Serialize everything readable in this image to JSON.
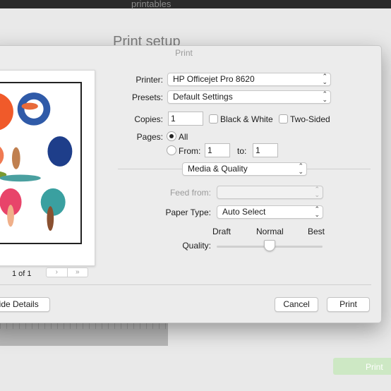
{
  "background": {
    "app_title": "printables",
    "page_title": "Print setup",
    "print_button": "Print"
  },
  "dialog": {
    "title": "Print",
    "printer_label": "Printer:",
    "printer_value": "HP Officejet Pro 8620",
    "presets_label": "Presets:",
    "presets_value": "Default Settings",
    "copies_label": "Copies:",
    "copies_value": "1",
    "bw_label": "Black & White",
    "two_sided_label": "Two-Sided",
    "pages_label": "Pages:",
    "all_label": "All",
    "from_label": "From:",
    "from_value": "1",
    "to_label": "to:",
    "to_value": "1",
    "section_value": "Media & Quality",
    "feed_label": "Feed from:",
    "feed_value": "",
    "paper_type_label": "Paper Type:",
    "paper_type_value": "Auto Select",
    "quality_label": "Quality:",
    "quality_draft": "Draft",
    "quality_normal": "Normal",
    "quality_best": "Best",
    "quality_level": 0.5,
    "page_indicator": "1 of 1",
    "nav_next": "›",
    "nav_last": "»",
    "hide_details": "Hide Details",
    "cancel": "Cancel",
    "print": "Print"
  },
  "colors": {
    "accent_print_bg": "#cde8c4"
  }
}
